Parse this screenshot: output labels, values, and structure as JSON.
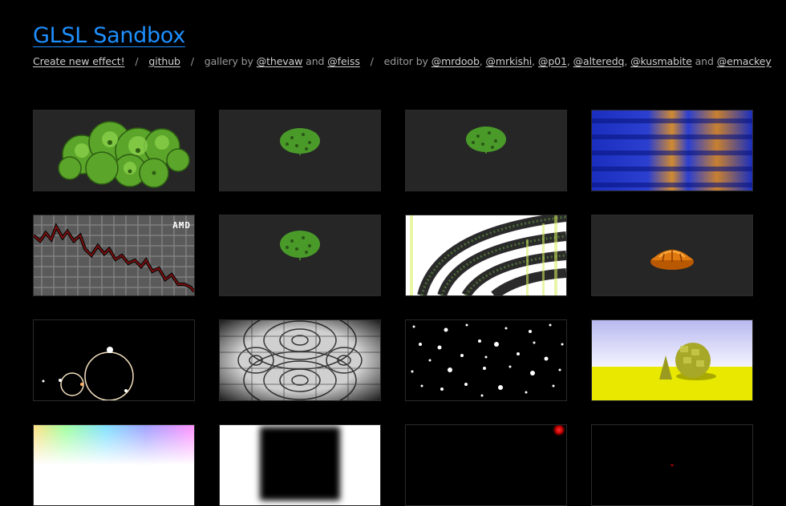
{
  "header": {
    "title": "GLSL Sandbox",
    "create_link": "Create new effect!",
    "github_link": "github",
    "gallery_by": "gallery by",
    "gallery_authors": [
      "@thevaw",
      "@feiss"
    ],
    "editor_by": "editor by",
    "editor_authors": [
      "@mrdoob",
      "@mrkishi",
      "@p01",
      "@alteredq",
      "@kusmabite",
      "@emackey"
    ],
    "and_word": "and",
    "separator": "/",
    "comma": ","
  },
  "gallery": {
    "thumbnails": [
      {
        "icon": "green-blob-cluster"
      },
      {
        "icon": "green-tree"
      },
      {
        "icon": "green-tree"
      },
      {
        "icon": "blue-orange-waves"
      },
      {
        "icon": "stock-chart",
        "label": "AMD"
      },
      {
        "icon": "green-tree"
      },
      {
        "icon": "noisy-arcs"
      },
      {
        "icon": "orange-shell"
      },
      {
        "icon": "mandelbrot-fractal"
      },
      {
        "icon": "interference-pattern"
      },
      {
        "icon": "dot-field"
      },
      {
        "icon": "yellow-voxel-scene"
      },
      {
        "icon": "rainbow-gradient"
      },
      {
        "icon": "blurred-black-square"
      },
      {
        "icon": "red-dot-corner"
      },
      {
        "icon": "tiny-red-dot"
      }
    ]
  },
  "colors": {
    "background": "#000000",
    "title": "#1e90ff",
    "link": "#cfcfcf",
    "text": "#9a9a9a"
  }
}
